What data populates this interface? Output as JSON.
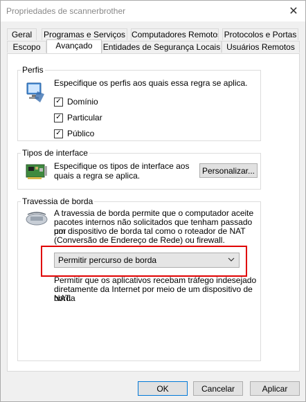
{
  "window": {
    "title": "Propriedades de scannerbrother",
    "close_glyph": "✕"
  },
  "tabs": {
    "row1": [
      "Geral",
      "Programas e Serviços",
      "Computadores Remotos",
      "Protocolos e Portas"
    ],
    "row2": [
      "Escopo",
      "Avançado",
      "Entidades de Segurança Locais",
      "Usuários Remotos"
    ],
    "active": "Avançado"
  },
  "profiles": {
    "legend": "Perfis",
    "description": "Especifique os perfis aos quais essa regra se aplica.",
    "checkboxes": [
      {
        "label": "Domínio",
        "checked": true
      },
      {
        "label": "Particular",
        "checked": true
      },
      {
        "label": "Público",
        "checked": true
      }
    ],
    "check_glyph": "✓"
  },
  "interface_types": {
    "legend": "Tipos de interface",
    "description_line1": "Especifique os tipos de interface aos",
    "description_line2": "quais a regra se aplica.",
    "customize_button": "Personalizar..."
  },
  "edge_traversal": {
    "legend": "Travessia de borda",
    "description_lines": [
      "A travessia de borda permite que o computador aceite",
      "pacotes internos não solicitados que tenham passado por",
      "um dispositivo de borda tal como o roteador de NAT",
      "(Conversão de Endereço de Rede) ou firewall."
    ],
    "selected_option": "Permitir percurso de borda",
    "help_lines": [
      "Permitir que os aplicativos recebam tráfego indesejado",
      "diretamente da Internet por meio de um dispositivo de borda",
      "NAT."
    ]
  },
  "footer": {
    "ok": "OK",
    "cancel": "Cancelar",
    "apply": "Aplicar"
  },
  "colors": {
    "highlight": "#e00000",
    "accent": "#0078d7"
  }
}
